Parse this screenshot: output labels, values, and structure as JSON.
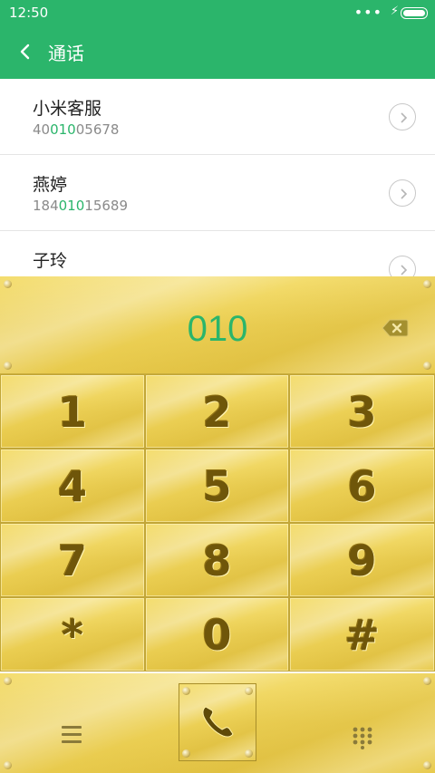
{
  "status": {
    "time": "12:50",
    "dots": "•••",
    "bolt": "⚡",
    "battery_level": 1.0
  },
  "header": {
    "title": "通话",
    "back_icon": "back-chevron-icon"
  },
  "contacts": [
    {
      "name": "小米客服",
      "number": {
        "pre": "40",
        "match": "010",
        "post": "05678"
      }
    },
    {
      "name": "燕婷",
      "number": {
        "pre": "184",
        "match": "010",
        "post": "15689"
      }
    },
    {
      "name": "子玲",
      "number": {
        "pre": "",
        "match": "",
        "post": ""
      }
    }
  ],
  "dialer": {
    "typed": "010",
    "backspace_icon": "backspace-icon",
    "keys": [
      "1",
      "2",
      "3",
      "4",
      "5",
      "6",
      "7",
      "8",
      "9",
      "*",
      "0",
      "#"
    ]
  },
  "bottom": {
    "menu_icon": "menu-icon",
    "call_icon": "phone-icon",
    "dialpad_icon": "dialpad-icon"
  },
  "colors": {
    "accent": "#2bb56b",
    "gold": "#ecd055",
    "gold_dark": "#6f560a"
  }
}
